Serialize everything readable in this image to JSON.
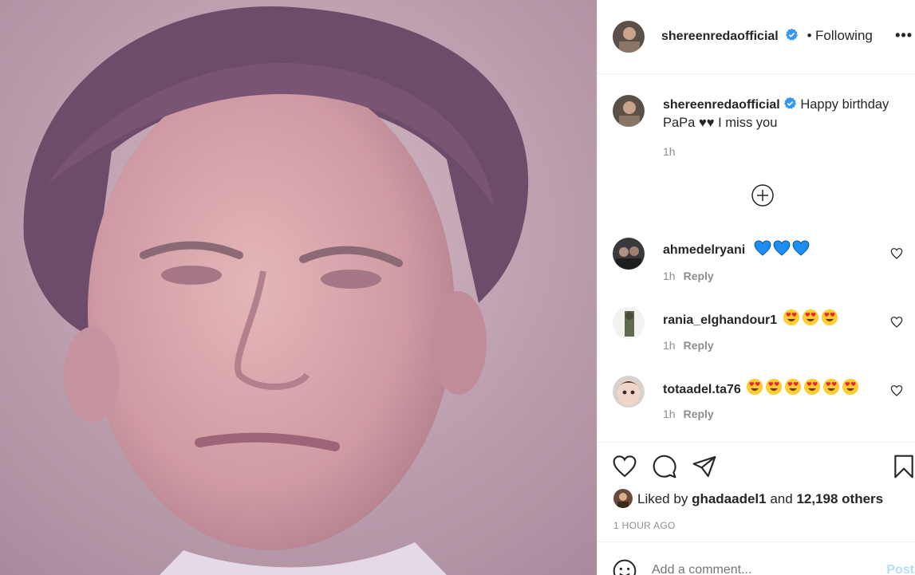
{
  "post": {
    "image_alt": "Portrait photo",
    "author": "shereenredaofficial",
    "follow_sep": "•",
    "follow_status": "Following",
    "more": "•••"
  },
  "caption": {
    "author": "shereenredaofficial",
    "text": "Happy birthday PaPa ♥♥ I miss you",
    "time": "1h"
  },
  "comments": [
    {
      "user": "ahmedelryani",
      "emojis": [
        "blue-heart",
        "blue-heart",
        "blue-heart"
      ],
      "time": "1h",
      "reply": "Reply"
    },
    {
      "user": "rania_elghandour1",
      "emojis": [
        "heart-eyes",
        "heart-eyes",
        "heart-eyes"
      ],
      "time": "1h",
      "reply": "Reply"
    },
    {
      "user": "totaadel.ta76",
      "emojis": [
        "heart-eyes",
        "heart-eyes",
        "heart-eyes",
        "heart-eyes",
        "heart-eyes",
        "heart-eyes"
      ],
      "time": "1h",
      "reply": "Reply"
    }
  ],
  "likes": {
    "prefix": "Liked by",
    "user": "ghadaadel1",
    "mid": "and",
    "count": "12,198 others"
  },
  "timestamp": "1 HOUR AGO",
  "add_comment": {
    "placeholder": "Add a comment...",
    "post_label": "Post"
  },
  "colors": {
    "verified": "#3897f0",
    "meta": "#8e8e8e",
    "post_button": "#b2dffc",
    "blue_heart": "#1d8df0",
    "emoji_yellow": "#ffcc33"
  }
}
